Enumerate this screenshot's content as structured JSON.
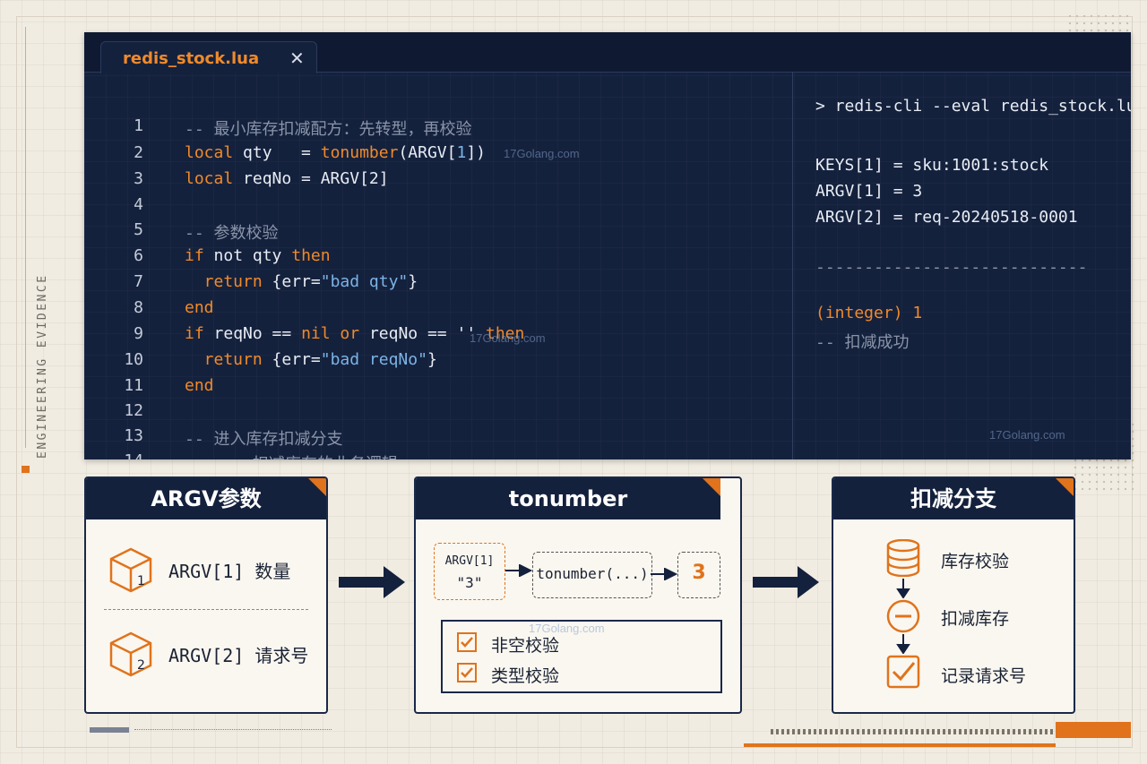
{
  "side_label": "ENGINEERING EVIDENCE",
  "editor": {
    "tab_title": "redis_stock.lua",
    "close_glyph": "✕",
    "code_lines": [
      {
        "n": "1",
        "segments": [
          {
            "t": "-- 最小库存扣减配方：先转型，再校验",
            "c": "c"
          }
        ]
      },
      {
        "n": "2",
        "segments": [
          {
            "t": "local",
            "c": "k"
          },
          {
            "t": " qty   = ",
            "c": ""
          },
          {
            "t": "tonumber",
            "c": "k"
          },
          {
            "t": "(ARGV[",
            "c": ""
          },
          {
            "t": "1",
            "c": "s"
          },
          {
            "t": "])",
            "c": ""
          }
        ]
      },
      {
        "n": "3",
        "segments": [
          {
            "t": "local",
            "c": "k"
          },
          {
            "t": " reqNo = ARGV[2]",
            "c": ""
          }
        ]
      },
      {
        "n": "4",
        "segments": []
      },
      {
        "n": "5",
        "segments": [
          {
            "t": "-- 参数校验",
            "c": "c"
          }
        ]
      },
      {
        "n": "6",
        "segments": [
          {
            "t": "if",
            "c": "k"
          },
          {
            "t": " not qty ",
            "c": ""
          },
          {
            "t": "then",
            "c": "k"
          }
        ]
      },
      {
        "n": "7",
        "segments": [
          {
            "t": "  return",
            "c": "k"
          },
          {
            "t": " {err=",
            "c": ""
          },
          {
            "t": "\"bad qty\"",
            "c": "s"
          },
          {
            "t": "}",
            "c": ""
          }
        ]
      },
      {
        "n": "8",
        "segments": [
          {
            "t": "end",
            "c": "k"
          }
        ]
      },
      {
        "n": "9",
        "segments": [
          {
            "t": "if",
            "c": "k"
          },
          {
            "t": " reqNo == ",
            "c": ""
          },
          {
            "t": "nil",
            "c": "k"
          },
          {
            "t": " ",
            "c": ""
          },
          {
            "t": "or",
            "c": "k"
          },
          {
            "t": " reqNo == '' ",
            "c": ""
          },
          {
            "t": "then",
            "c": "k"
          }
        ]
      },
      {
        "n": "10",
        "segments": [
          {
            "t": "  return",
            "c": "k"
          },
          {
            "t": " {err=",
            "c": ""
          },
          {
            "t": "\"bad reqNo\"",
            "c": "s"
          },
          {
            "t": "}",
            "c": ""
          }
        ]
      },
      {
        "n": "11",
        "segments": [
          {
            "t": "end",
            "c": "k"
          }
        ]
      },
      {
        "n": "12",
        "segments": []
      },
      {
        "n": "13",
        "segments": [
          {
            "t": "-- 进入库存扣减分支",
            "c": "c"
          }
        ]
      },
      {
        "n": "14",
        "segments": [
          {
            "t": "-- ... 扣减库存的业务逻辑",
            "c": "c"
          }
        ]
      }
    ]
  },
  "terminal": {
    "command": "> redis-cli --eval redis_stock.lua",
    "keys1": "KEYS[1] = sku:1001:stock",
    "argv1": "ARGV[1] = 3",
    "argv2": "ARGV[2] = req-20240518-0001",
    "separator": "----------------------------",
    "result": "(integer) 1",
    "result_comment": "-- 扣减成功"
  },
  "panels": {
    "argv": {
      "title": "ARGV参数",
      "item1_label": "ARGV[1] 数量",
      "item1_num": "1",
      "item2_label": "ARGV[2] 请求号",
      "item2_num": "2"
    },
    "tonumber": {
      "title": "tonumber",
      "input_label": "ARGV[1]",
      "input_value": "\"3\"",
      "func_label": "tonumber(...)",
      "output_value": "3",
      "check1": "非空校验",
      "check2": "类型校验"
    },
    "deduct": {
      "title": "扣减分支",
      "step1": "库存校验",
      "step2": "扣减库存",
      "step3": "记录请求号"
    }
  },
  "watermarks": {
    "text": "17Golang.com"
  },
  "colors": {
    "navy": "#14213d",
    "orange": "#e0731c",
    "paper": "#f1ece2"
  }
}
